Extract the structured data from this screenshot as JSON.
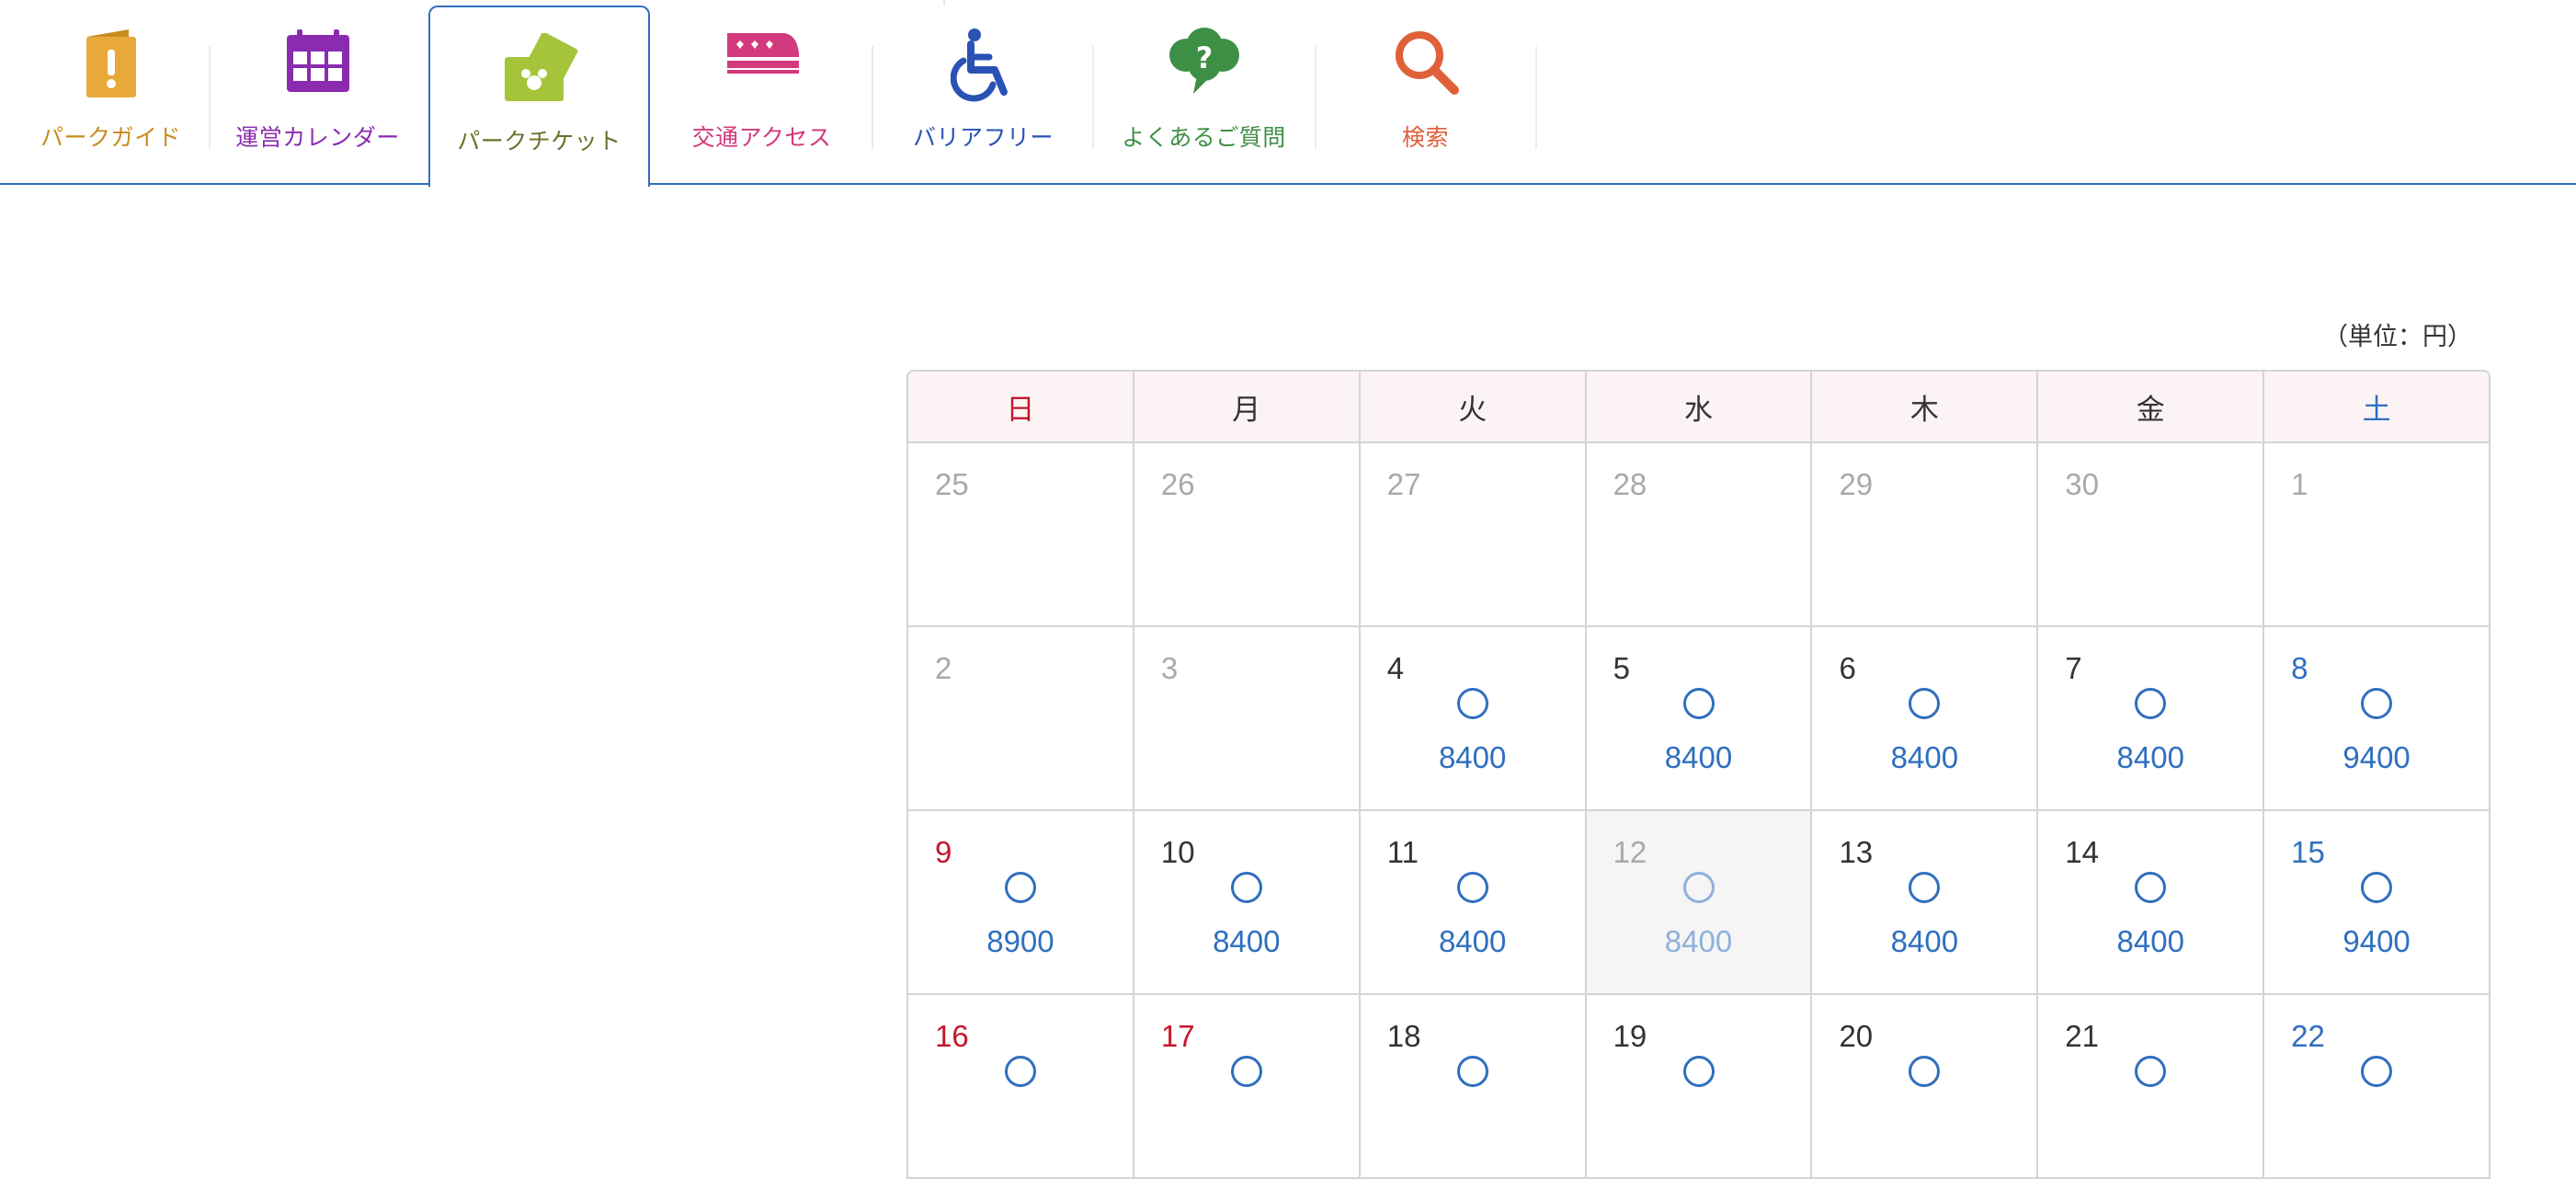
{
  "nav": {
    "items": [
      {
        "label": "パークガイド",
        "icon": "guide-book-icon",
        "color": "#c98b1f"
      },
      {
        "label": "運営カレンダー",
        "icon": "calendar-icon",
        "color": "#8a2bb0"
      },
      {
        "label": "パークチケット",
        "icon": "ticket-icon",
        "color": "#6e6e2a"
      },
      {
        "label": "交通アクセス",
        "icon": "train-icon",
        "color": "#d23a7d"
      },
      {
        "label": "バリアフリー",
        "icon": "wheelchair-icon",
        "color": "#2a52b5"
      },
      {
        "label": "よくあるご質問",
        "icon": "faq-bubble-icon",
        "color": "#3e8f46"
      },
      {
        "label": "検索",
        "icon": "search-icon",
        "color": "#e0603a"
      }
    ],
    "active_index": 2
  },
  "unit_label": "（単位：円）",
  "calendar": {
    "weekdays": [
      "日",
      "月",
      "火",
      "水",
      "木",
      "金",
      "土"
    ],
    "weeks": [
      [
        {
          "day": "25",
          "status": "",
          "price": "",
          "past": true
        },
        {
          "day": "26",
          "status": "",
          "price": "",
          "past": true
        },
        {
          "day": "27",
          "status": "",
          "price": "",
          "past": true
        },
        {
          "day": "28",
          "status": "",
          "price": "",
          "past": true
        },
        {
          "day": "29",
          "status": "",
          "price": "",
          "past": true
        },
        {
          "day": "30",
          "status": "",
          "price": "",
          "past": true
        },
        {
          "day": "1",
          "status": "",
          "price": "",
          "past": true
        }
      ],
      [
        {
          "day": "2",
          "status": "",
          "price": "",
          "past": true
        },
        {
          "day": "3",
          "status": "",
          "price": "",
          "past": true
        },
        {
          "day": "4",
          "status": "available",
          "price": "8400"
        },
        {
          "day": "5",
          "status": "available",
          "price": "8400"
        },
        {
          "day": "6",
          "status": "available",
          "price": "8400"
        },
        {
          "day": "7",
          "status": "available",
          "price": "8400"
        },
        {
          "day": "8",
          "status": "available",
          "price": "9400"
        }
      ],
      [
        {
          "day": "9",
          "status": "available",
          "price": "8900"
        },
        {
          "day": "10",
          "status": "available",
          "price": "8400"
        },
        {
          "day": "11",
          "status": "available",
          "price": "8400"
        },
        {
          "day": "12",
          "status": "available",
          "price": "8400",
          "selected": true,
          "past": true
        },
        {
          "day": "13",
          "status": "available",
          "price": "8400"
        },
        {
          "day": "14",
          "status": "available",
          "price": "8400"
        },
        {
          "day": "15",
          "status": "available",
          "price": "9400"
        }
      ],
      [
        {
          "day": "16",
          "status": "available",
          "price": ""
        },
        {
          "day": "17",
          "status": "available",
          "price": "",
          "holiday": true
        },
        {
          "day": "18",
          "status": "available",
          "price": ""
        },
        {
          "day": "19",
          "status": "available",
          "price": ""
        },
        {
          "day": "20",
          "status": "available",
          "price": ""
        },
        {
          "day": "21",
          "status": "available",
          "price": ""
        },
        {
          "day": "22",
          "status": "available",
          "price": ""
        }
      ]
    ]
  }
}
